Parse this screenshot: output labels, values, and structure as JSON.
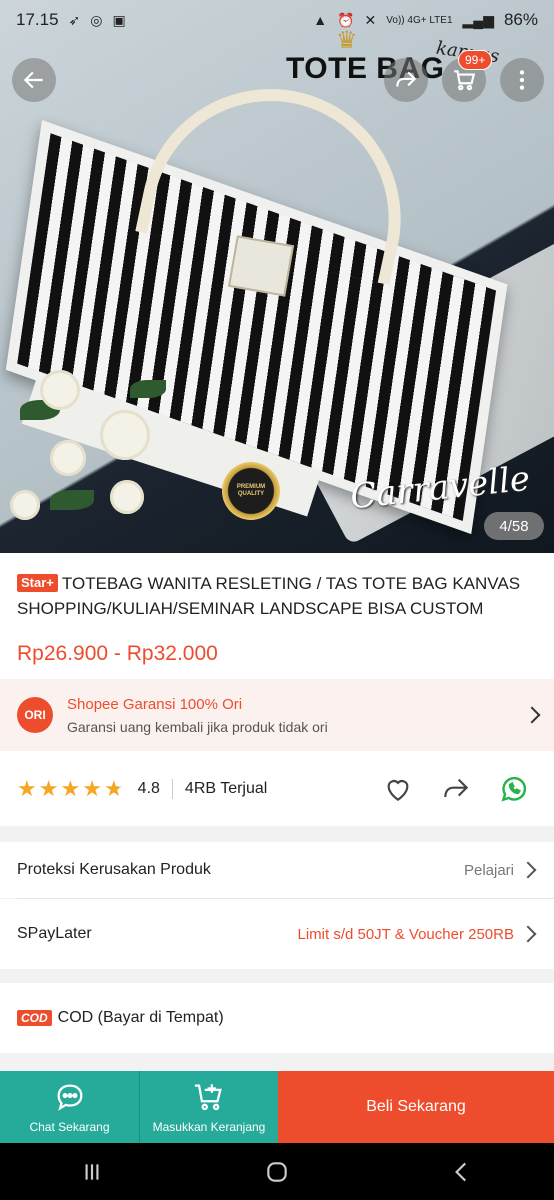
{
  "status_bar": {
    "time": "17.15",
    "signal": "Vo)) 4G+ LTE1",
    "battery": "86%"
  },
  "hero": {
    "brand_title": "TOTE BAG",
    "brand_sub": "kanvas",
    "badge_line1": "PREMIUM",
    "badge_line2": "QUALITY",
    "signature": "Carravelle",
    "image_counter": "4/58",
    "cart_count": "99+"
  },
  "product": {
    "badge": "Star+",
    "title": "TOTEBAG WANITA RESLETING / TAS TOTE BAG KANVAS SHOPPING/KULIAH/SEMINAR LANDSCAPE BISA CUSTOM",
    "price": "Rp26.900 - Rp32.000"
  },
  "garansi": {
    "ori_label": "ORI",
    "title": "Shopee Garansi 100% Ori",
    "subtitle": "Garansi uang kembali jika produk tidak ori"
  },
  "rating": {
    "stars": 4.8,
    "value": "4.8",
    "sold": "4RB Terjual"
  },
  "rows": {
    "protection_label": "Proteksi Kerusakan Produk",
    "protection_action": "Pelajari",
    "paylater_label": "SPayLater",
    "paylater_value": "Limit s/d 50JT & Voucher 250RB",
    "cod_tag": "COD",
    "cod_label": "COD (Bayar di Tempat)"
  },
  "bottom_bar": {
    "chat_label": "Chat Sekarang",
    "cart_label": "Masukkan Keranjang",
    "buy_label": "Beli Sekarang"
  },
  "colors": {
    "accent": "#ee4d2d",
    "teal": "#26aa99",
    "whatsapp": "#25b34a",
    "star": "#f5a623"
  }
}
